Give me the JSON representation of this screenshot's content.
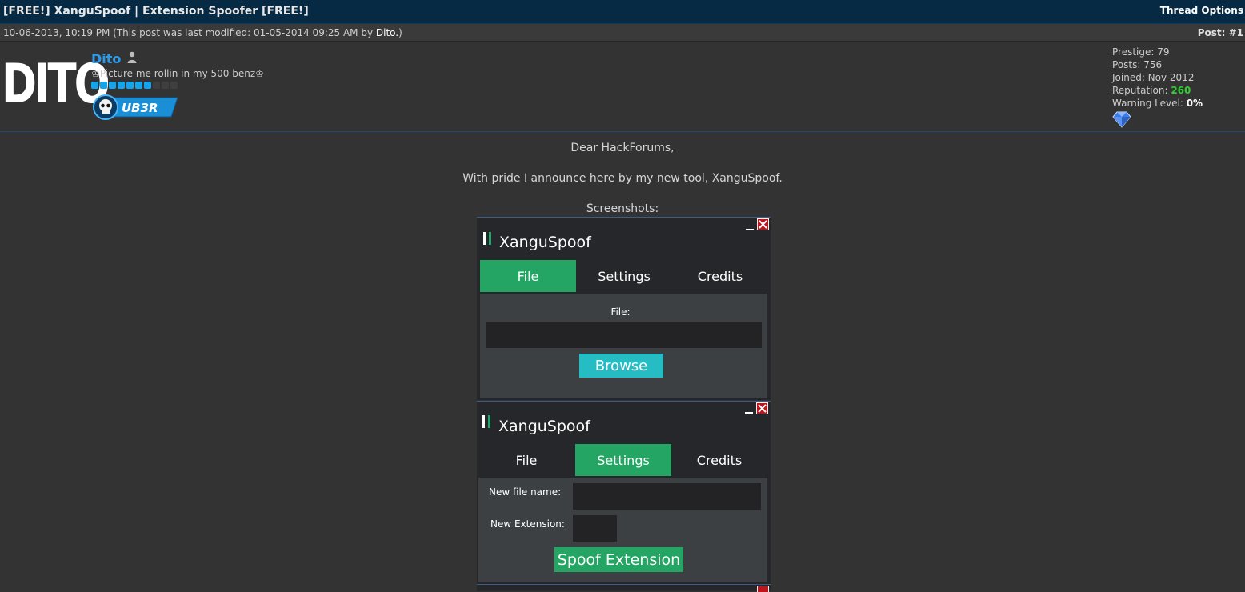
{
  "thread": {
    "title": "[FREE!] XanguSpoof | Extension Spoofer [FREE!]",
    "options_label": "Thread Options"
  },
  "post": {
    "date": "10-06-2013, 10:19 PM (This post was last modified: 01-05-2014 09:25 AM by ",
    "modified_by": "Dito.",
    "date_suffix": ")",
    "number": "Post: #1"
  },
  "author": {
    "avatar_text": "DITO",
    "name": "Dito",
    "user_title": "♔Picture me rollin in my 500 benz♔",
    "rep_dots_filled": 7,
    "rep_dots_total": 10,
    "badge_text": "UB3R",
    "stats": {
      "prestige": "Prestige: 79",
      "posts": "Posts: 756",
      "joined": "Joined: Nov 2012",
      "reputation_label": "Reputation: ",
      "reputation_value": "260",
      "warning_label": "Warning Level: ",
      "warning_value": "0%"
    },
    "icons": {
      "status": "offline-person-icon",
      "award": "diamond-gem-icon"
    }
  },
  "message": {
    "greeting": "Dear HackForums,",
    "announcement": "With pride I announce here by my new tool, XanguSpoof.",
    "screenshots_label": "Screenshots:"
  },
  "screenshot1": {
    "app_title": "XanguSpoof",
    "tabs": [
      "File",
      "Settings",
      "Credits"
    ],
    "active_tab": 0,
    "file_label": "File:",
    "browse_label": "Browse"
  },
  "screenshot2": {
    "app_title": "XanguSpoof",
    "tabs": [
      "File",
      "Settings",
      "Credits"
    ],
    "active_tab": 1,
    "new_file_name_label": "New file name:",
    "new_extension_label": "New Extension:",
    "spoof_label": "Spoof Extension"
  },
  "colors": {
    "accent_green": "#25a564",
    "browse_teal": "#26bcc4",
    "close_red": "#c0141c",
    "username_blue": "#2a9cf0",
    "header_navy": "#072a44"
  }
}
